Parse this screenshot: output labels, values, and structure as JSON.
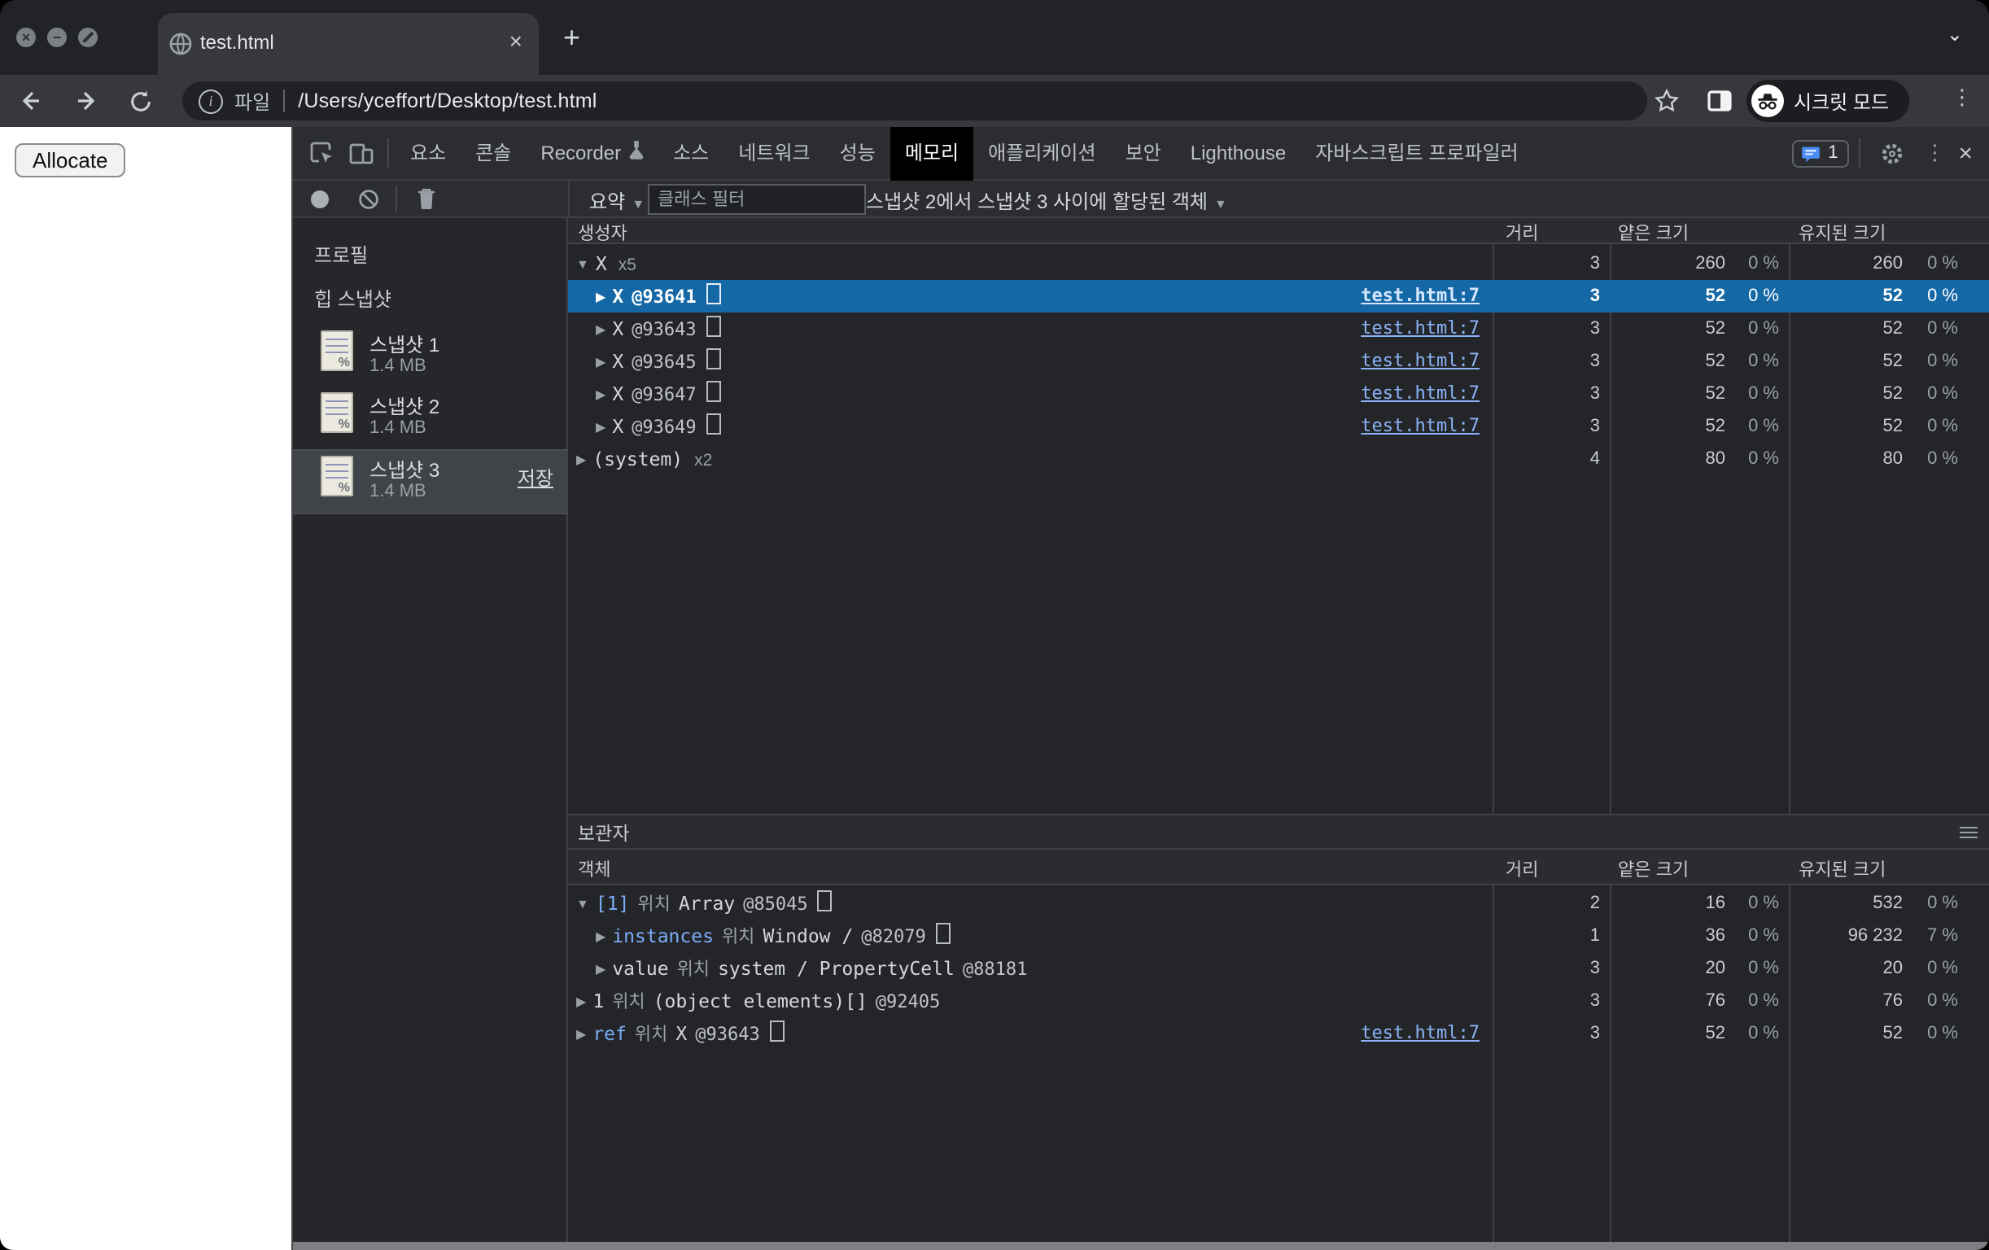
{
  "browser": {
    "tab_title": "test.html",
    "url": "/Users/yceffort/Desktop/test.html",
    "scheme_chip": "파일",
    "incognito_label": "시크릿 모드"
  },
  "page": {
    "allocate_label": "Allocate"
  },
  "devtools": {
    "tabs": [
      {
        "label": "요소"
      },
      {
        "label": "콘솔"
      },
      {
        "label": "Recorder"
      },
      {
        "label": "소스"
      },
      {
        "label": "네트워크"
      },
      {
        "label": "성능"
      },
      {
        "label": "메모리"
      },
      {
        "label": "애플리케이션"
      },
      {
        "label": "보안"
      },
      {
        "label": "Lighthouse"
      },
      {
        "label": "자바스크립트 프로파일러"
      }
    ],
    "active_tab": "메모리",
    "issues_count": "1",
    "filter_bar": {
      "summary_label": "요약",
      "class_filter_placeholder": "클래스 필터",
      "scope_label": "스냅샷 2에서 스냅샷 3 사이에 할당된 객체"
    },
    "sidebar": {
      "profiles_label": "프로필",
      "heap_section_label": "힙 스냅샷",
      "save_label": "저장",
      "snapshots": [
        {
          "label": "스냅샷 1",
          "size": "1.4 MB"
        },
        {
          "label": "스냅샷 2",
          "size": "1.4 MB"
        },
        {
          "label": "스냅샷 3",
          "size": "1.4 MB"
        }
      ]
    },
    "columns": {
      "distance": "거리",
      "shallow": "얕은 크기",
      "retained": "유지된 크기"
    },
    "constructors": {
      "section_label": "생성자",
      "rows": [
        {
          "name": "X",
          "count": "x5",
          "distance": "3",
          "shallow": "260",
          "shallow_pct": "0 %",
          "retained": "260",
          "retained_pct": "0 %"
        },
        {
          "name": "X",
          "id": "@93641",
          "link": "test.html:7",
          "distance": "3",
          "shallow": "52",
          "shallow_pct": "0 %",
          "retained": "52",
          "retained_pct": "0 %"
        },
        {
          "name": "X",
          "id": "@93643",
          "link": "test.html:7",
          "distance": "3",
          "shallow": "52",
          "shallow_pct": "0 %",
          "retained": "52",
          "retained_pct": "0 %"
        },
        {
          "name": "X",
          "id": "@93645",
          "link": "test.html:7",
          "distance": "3",
          "shallow": "52",
          "shallow_pct": "0 %",
          "retained": "52",
          "retained_pct": "0 %"
        },
        {
          "name": "X",
          "id": "@93647",
          "link": "test.html:7",
          "distance": "3",
          "shallow": "52",
          "shallow_pct": "0 %",
          "retained": "52",
          "retained_pct": "0 %"
        },
        {
          "name": "X",
          "id": "@93649",
          "link": "test.html:7",
          "distance": "3",
          "shallow": "52",
          "shallow_pct": "0 %",
          "retained": "52",
          "retained_pct": "0 %"
        },
        {
          "name": "(system)",
          "count": "x2",
          "distance": "4",
          "shallow": "80",
          "shallow_pct": "0 %",
          "retained": "80",
          "retained_pct": "0 %"
        }
      ]
    },
    "retainers": {
      "section_label": "보관자",
      "object_column": "객체",
      "rows": [
        {
          "prop": "[1]",
          "rel": "위치",
          "obj": "Array",
          "id": "@85045",
          "distance": "2",
          "shallow": "16",
          "shallow_pct": "0 %",
          "retained": "532",
          "retained_pct": "0 %"
        },
        {
          "prop": "instances",
          "rel": "위치",
          "obj": "Window /",
          "id": "@82079",
          "distance": "1",
          "shallow": "36",
          "shallow_pct": "0 %",
          "retained": "96 232",
          "retained_pct": "7 %"
        },
        {
          "prop": "value",
          "rel": "위치",
          "obj": "system / PropertyCell",
          "id": "@88181",
          "distance": "3",
          "shallow": "20",
          "shallow_pct": "0 %",
          "retained": "20",
          "retained_pct": "0 %"
        },
        {
          "prop": "1",
          "rel": "위치",
          "obj": "(object elements)[]",
          "id": "@92405",
          "distance": "3",
          "shallow": "76",
          "shallow_pct": "0 %",
          "retained": "76",
          "retained_pct": "0 %"
        },
        {
          "prop": "ref",
          "rel": "위치",
          "obj": "X",
          "id": "@93643",
          "link": "test.html:7",
          "distance": "3",
          "shallow": "52",
          "shallow_pct": "0 %",
          "retained": "52",
          "retained_pct": "0 %"
        }
      ]
    }
  },
  "colors": {
    "selection": "#1568a6",
    "link": "#8ab4f8",
    "prop_blue": "#7cacf8",
    "issues_badge": "#4c8df8"
  }
}
